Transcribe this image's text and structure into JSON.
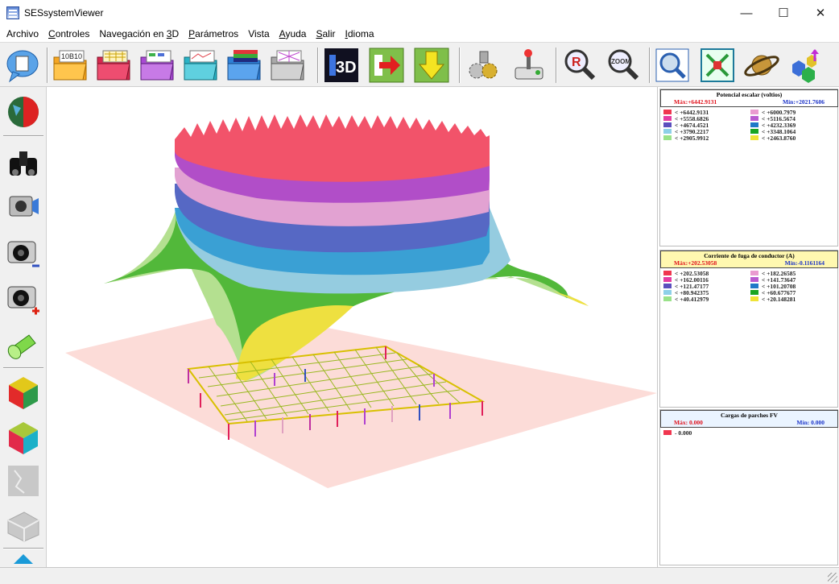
{
  "window": {
    "title": "SESsystemViewer",
    "minimize": "—",
    "maximize": "☐",
    "close": "✕"
  },
  "menu": [
    {
      "pre": "Archivo",
      "u": "",
      "post": ""
    },
    {
      "pre": "",
      "u": "C",
      "post": "ontroles"
    },
    {
      "pre": "Navegación en ",
      "u": "3",
      "post": "D"
    },
    {
      "pre": "",
      "u": "P",
      "post": "arámetros"
    },
    {
      "pre": "Vista",
      "u": "",
      "post": ""
    },
    {
      "pre": "",
      "u": "A",
      "post": "yuda"
    },
    {
      "pre": "",
      "u": "S",
      "post": "alir"
    },
    {
      "pre": "",
      "u": "I",
      "post": "dioma"
    }
  ],
  "toolbar": [
    {
      "name": "speech-bubble-icon"
    },
    {
      "name": "open-folder-data-icon",
      "text": "10B10"
    },
    {
      "name": "open-folder-grid-icon"
    },
    {
      "name": "open-folder-layers-icon"
    },
    {
      "name": "open-folder-map-icon"
    },
    {
      "name": "open-folder-stack-icon"
    },
    {
      "name": "open-folder-mesh-icon"
    },
    {
      "name": "3d-view-icon",
      "text": "3D"
    },
    {
      "name": "arrow-right-icon"
    },
    {
      "name": "arrow-down-icon"
    },
    {
      "name": "settings-gears-icon"
    },
    {
      "name": "joystick-icon"
    },
    {
      "name": "zoom-rotate-icon",
      "text": "R"
    },
    {
      "name": "zoom-icon",
      "text": "ZOOM"
    },
    {
      "name": "magnifier-window-icon"
    },
    {
      "name": "fit-window-icon"
    },
    {
      "name": "saturn-icon"
    },
    {
      "name": "cubes-up-icon"
    }
  ],
  "lefttools": [
    {
      "name": "half-sphere-icon"
    },
    {
      "name": "binoculars-icon"
    },
    {
      "name": "camcorder-icon"
    },
    {
      "name": "camera-zoom-out-icon"
    },
    {
      "name": "camera-zoom-in-icon"
    },
    {
      "name": "flashlight-icon"
    },
    {
      "name": "cube-red-icon"
    },
    {
      "name": "cube-green-icon"
    },
    {
      "name": "disabled-panel-icon"
    },
    {
      "name": "disabled-brick-icon"
    },
    {
      "name": "arrow-up-icon"
    }
  ],
  "legends": [
    {
      "title": "Potencial escalar (voltios)",
      "max": "Máx:+6442.9131",
      "min": "Mín:+2021.7606",
      "rows": [
        {
          "color": "#f0364f",
          "label": "< +6442.9131"
        },
        {
          "color": "#ea9ad0",
          "label": "< +6000.7979"
        },
        {
          "color": "#e43ca2",
          "label": "< +5558.6826"
        },
        {
          "color": "#b95ad0",
          "label": "< +5116.5674"
        },
        {
          "color": "#5b4fbd",
          "label": "< +4674.4521"
        },
        {
          "color": "#1f79c8",
          "label": "< +4232.3369"
        },
        {
          "color": "#8ed0e8",
          "label": "< +3790.2217"
        },
        {
          "color": "#19a523",
          "label": "< +3348.1064"
        },
        {
          "color": "#9ae28a",
          "label": "< +2905.9912"
        },
        {
          "color": "#efe337",
          "label": "< +2463.8760"
        }
      ]
    },
    {
      "title": "Corriente de fuga de conductor (A)",
      "max": "Máx:+202.53058",
      "min": "Mín:-0.1161164",
      "rows": [
        {
          "color": "#f0364f",
          "label": "< +202.53058"
        },
        {
          "color": "#ea9ad0",
          "label": "< +182.26585"
        },
        {
          "color": "#e43ca2",
          "label": "< +162.00116"
        },
        {
          "color": "#b95ad0",
          "label": "< +141.73647"
        },
        {
          "color": "#5b4fbd",
          "label": "< +121.47177"
        },
        {
          "color": "#1f79c8",
          "label": "< +101.20708"
        },
        {
          "color": "#8ed0e8",
          "label": "< +80.942375"
        },
        {
          "color": "#19a523",
          "label": "< +60.677677"
        },
        {
          "color": "#9ae28a",
          "label": "< +40.412979"
        },
        {
          "color": "#efe337",
          "label": "< +20.148281"
        }
      ]
    },
    {
      "title": "Cargas de parches FV",
      "max": "Máx: 0.000",
      "min": "Mín: 0.000",
      "rows": [
        {
          "color": "#f0364f",
          "label": "- 0.000"
        }
      ]
    }
  ]
}
